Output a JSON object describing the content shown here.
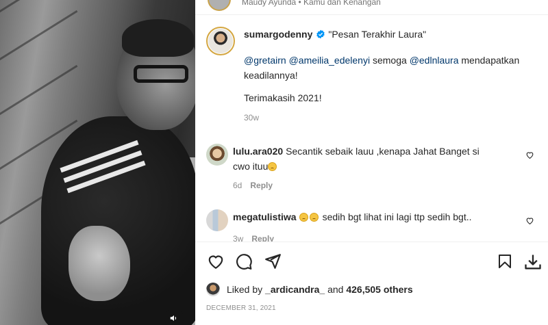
{
  "post": {
    "audio_line": "Maudy Ayunda • Kamu dan Kenangan",
    "author": "sumargodenny",
    "caption_title": "\"Pesan Terakhir Laura\"",
    "caption_mentions": [
      "@gretairn",
      "@ameilia_edelenyi"
    ],
    "caption_text_1": " semoga ",
    "caption_mention_3": "@edlnlaura",
    "caption_text_2": " mendapatkan keadilannya!",
    "caption_thanks": "Terimakasih 2021!",
    "caption_age": "30w",
    "likes_prefix": "Liked by ",
    "likes_user": "_ardicandra_",
    "likes_middle": " and ",
    "likes_count": "426,505 others",
    "date": "DECEMBER 31, 2021"
  },
  "comments": [
    {
      "user": "lulu.ara020",
      "text": "Secantik sebaik lauu ,kenapa Jahat Banget si cwo ituu",
      "emoji": "worried-face",
      "age": "6d",
      "reply_label": "Reply"
    },
    {
      "user": "megatulistiwa",
      "emoji_lead": "worried-face",
      "text": "sedih bgt lihat ini lagi ttp sedih bgt..",
      "age": "3w",
      "reply_label": "Reply"
    }
  ],
  "icons": {
    "like": "heart-icon",
    "comment": "comment-icon",
    "share": "share-icon",
    "save": "bookmark-icon",
    "download": "download-icon",
    "sound": "speaker-icon",
    "verified": "verified-badge-icon"
  },
  "colors": {
    "link": "#00376b",
    "verified": "#0095f6",
    "muted": "#8e8e8e",
    "text": "#262626"
  }
}
